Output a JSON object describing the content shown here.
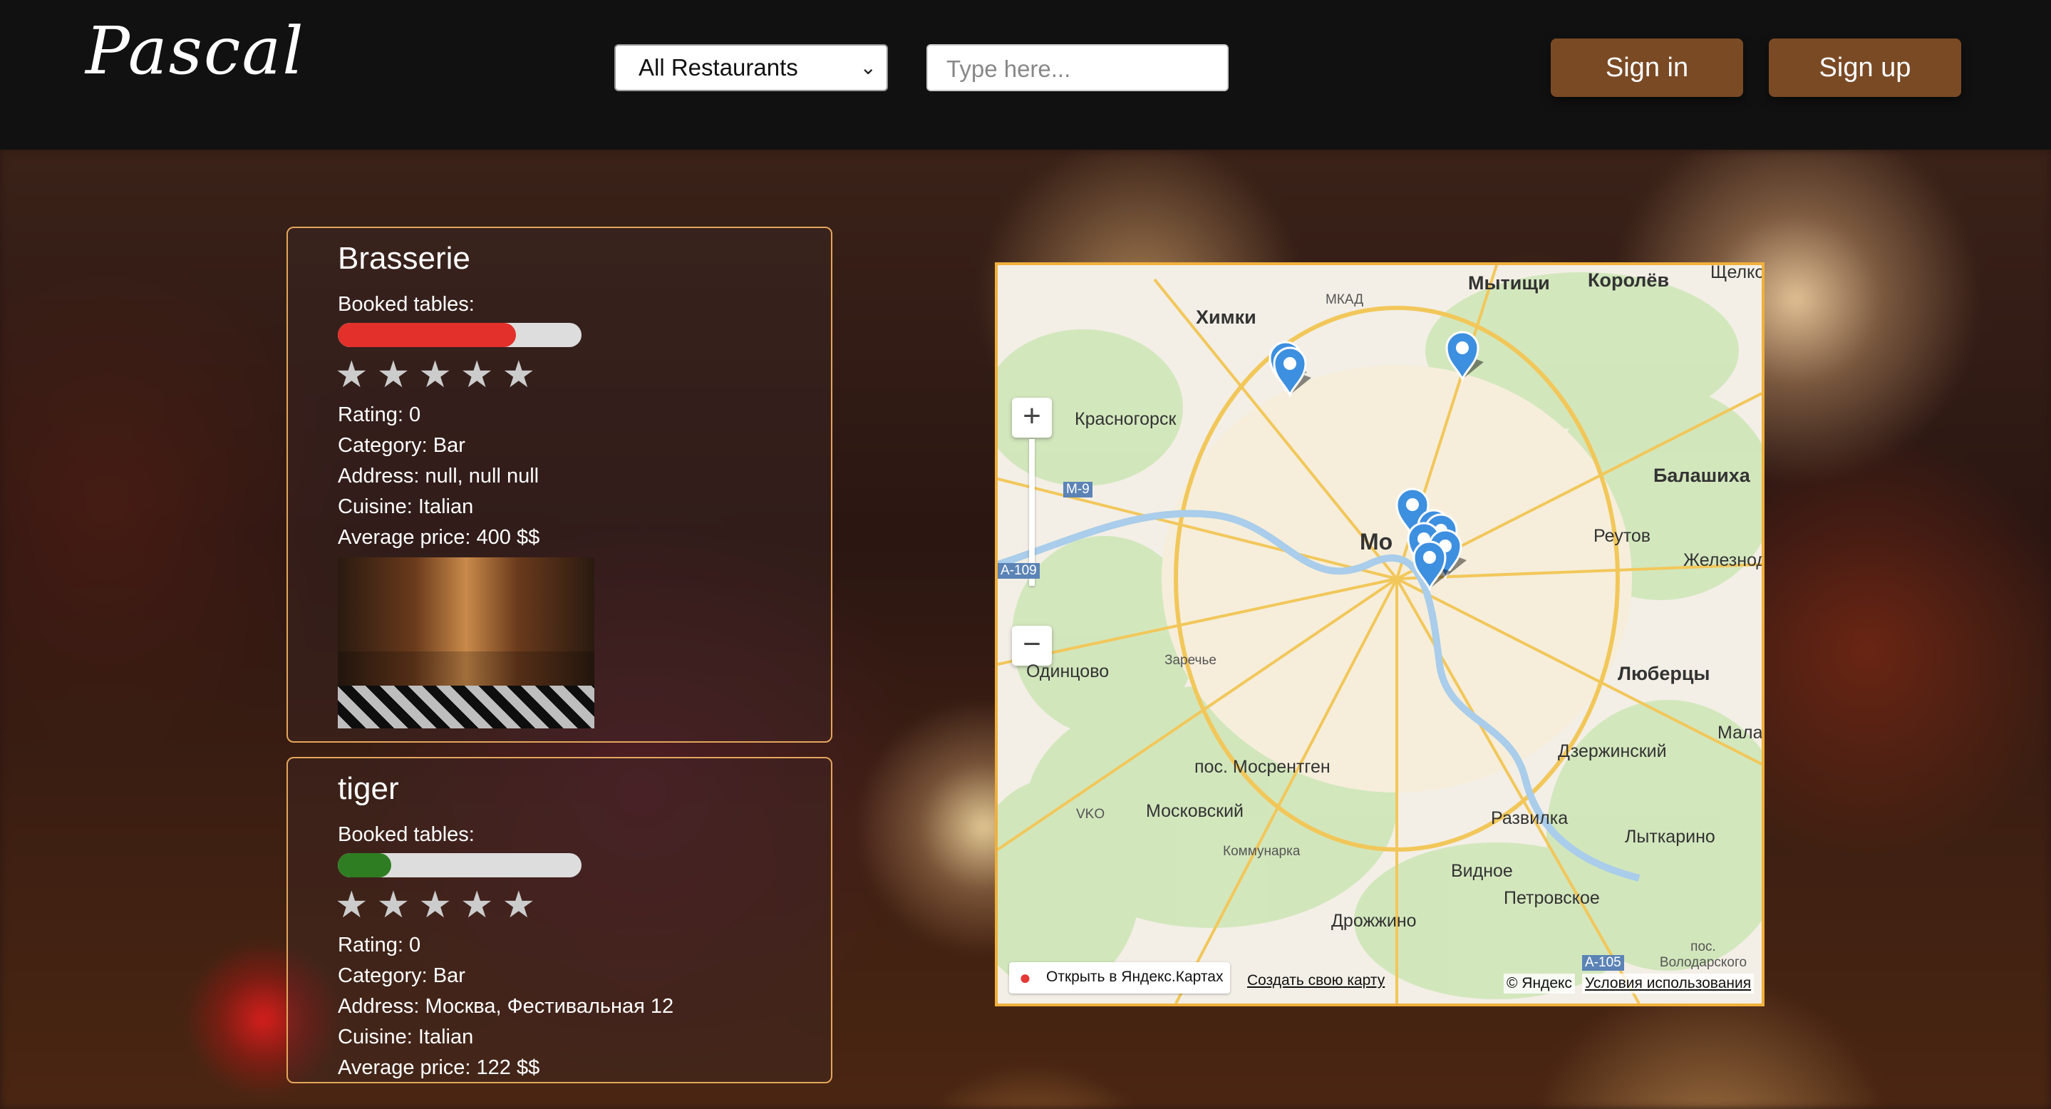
{
  "header": {
    "logo": "Pascal",
    "filter_select": "All Restaurants",
    "search_placeholder": "Type here...",
    "sign_in": "Sign in",
    "sign_up": "Sign up"
  },
  "restaurants": [
    {
      "name": "Brasserie",
      "booked_label": "Booked tables:",
      "booked_fraction": 0.73,
      "booked_color": "#e3302a",
      "stars_filled": 0,
      "stars_total": 5,
      "rating": "Rating: 0",
      "category": "Category: Bar",
      "address": "Address: null, null null",
      "cuisine": "Cuisine: Italian",
      "price": "Average price: 400 $$"
    },
    {
      "name": "tiger",
      "booked_label": "Booked tables:",
      "booked_fraction": 0.22,
      "booked_color": "#2e7d22",
      "stars_filled": 0,
      "stars_total": 5,
      "rating": "Rating: 0",
      "category": "Category: Bar",
      "address": "Address: Москва, Фестивальная 12",
      "cuisine": "Cuisine: Italian",
      "price": "Average price: 122 $$"
    }
  ],
  "map": {
    "labels": {
      "himki": "Химки",
      "mytishchi": "Мытищи",
      "korolev": "Королёв",
      "shchelk": "Щелко",
      "krasnogorsk": "Красногорск",
      "balashikha": "Балашиха",
      "reutov": "Реутов",
      "zheleznod": "Железнод",
      "moscow": "Мо",
      "odintsovo": "Одинцово",
      "zarechye": "Заречье",
      "lyubertsy": "Люберцы",
      "dzerzhinsky": "Дзержинский",
      "mala": "Мала",
      "mosrentgen": "пос. Мосрентген",
      "moskovsky": "Московский",
      "razvilka": "Развилка",
      "lytkarino": "Лыткарино",
      "kommunarka": "Коммунарка",
      "vidnoe": "Видное",
      "petrovskoe": "Петровское",
      "drozhzhino": "Дрожжино",
      "volodarskogo": "пос. Володарского",
      "vko": "VKO",
      "mkad": "МКАД",
      "m9": "М-9",
      "a105": "А-105",
      "a109": "А-109"
    },
    "zoom_in": "+",
    "zoom_out": "−",
    "open_link": "Открыть в Яндекс.Картах",
    "create_link": "Создать свою карту",
    "copyright": "© Яндекс",
    "terms": "Условия использования"
  },
  "icons": {
    "select_chevron": "chevron-down-icon",
    "star": "star-icon",
    "map_pin": "map-pin-icon",
    "open_pin": "location-pin-icon"
  }
}
